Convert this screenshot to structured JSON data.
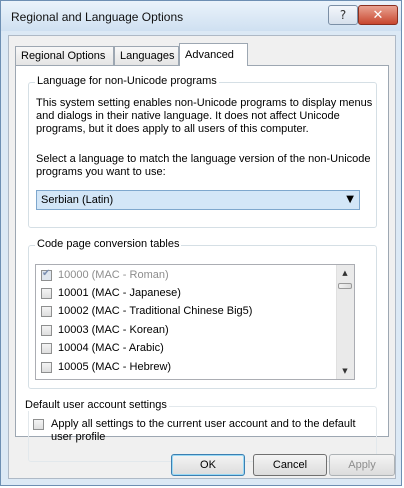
{
  "window": {
    "title": "Regional and Language Options",
    "help_glyph": "?",
    "close_glyph": "✕"
  },
  "tabs": [
    {
      "label": "Regional Options"
    },
    {
      "label": "Languages"
    },
    {
      "label": "Advanced",
      "selected": true
    }
  ],
  "nonunicode": {
    "group_label": "Language for non-Unicode programs",
    "description": [
      "This system setting enables non-Unicode programs to display menus",
      "and dialogs in their native language. It does not affect Unicode",
      "programs, but it does apply to all users of this computer."
    ],
    "select_prompt": [
      "Select a language to match the language version of the non-Unicode",
      "programs you want to use:"
    ],
    "selected_language": "Serbian (Latin)"
  },
  "codepage": {
    "group_label": "Code page conversion tables",
    "items": [
      {
        "label": "10000 (MAC - Roman)",
        "checked": true,
        "disabled": true
      },
      {
        "label": "10001 (MAC - Japanese)",
        "checked": false
      },
      {
        "label": "10002 (MAC - Traditional Chinese Big5)",
        "checked": false
      },
      {
        "label": "10003 (MAC - Korean)",
        "checked": false
      },
      {
        "label": "10004 (MAC - Arabic)",
        "checked": false
      },
      {
        "label": "10005 (MAC - Hebrew)",
        "checked": false
      }
    ]
  },
  "default_account": {
    "group_label": "Default user account settings",
    "checkbox_label": [
      "Apply all settings to the current user account and to the default",
      "user profile"
    ]
  },
  "buttons": {
    "ok": "OK",
    "cancel": "Cancel",
    "apply": "Apply"
  },
  "colors": {
    "combo_highlight": "#d3e6f7",
    "title_gradient_top": "#eaf3fb",
    "close_button": "#c8472f"
  }
}
